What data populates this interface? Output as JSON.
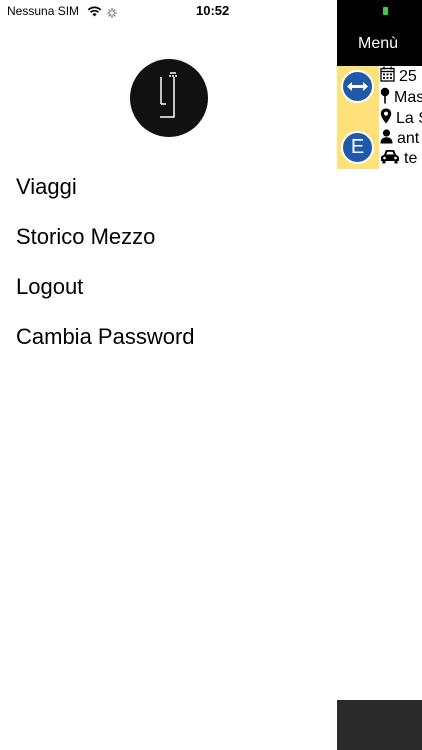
{
  "status_bar": {
    "carrier": "Nessuna SIM",
    "time": "10:52"
  },
  "side_menu": {
    "logo_icon": "brand-logo-icon",
    "items": [
      {
        "label": "Viaggi"
      },
      {
        "label": "Storico Mezzo"
      },
      {
        "label": "Logout"
      },
      {
        "label": "Cambia Password"
      }
    ]
  },
  "background_screen": {
    "header_title": "Menù",
    "trip_card": {
      "sign_letter": "E",
      "date": "25",
      "departure": "Mas",
      "destination": "La S",
      "person": "ant",
      "vehicle": "te"
    }
  },
  "colors": {
    "header_bg": "#000000",
    "strip_yellow": "#ffe17a",
    "sign_blue": "#1f5aa8",
    "battery_green": "#35d04a"
  }
}
